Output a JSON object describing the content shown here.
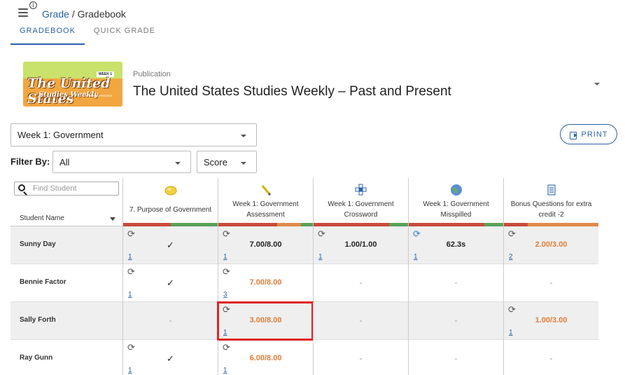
{
  "header": {
    "breadcrumb_parent": "Grade",
    "breadcrumb_sep": "/",
    "breadcrumb_current": "Gradebook",
    "info_glyph": "i"
  },
  "tabs": [
    {
      "label": "GRADEBOOK",
      "active": true
    },
    {
      "label": "QUICK GRADE",
      "active": false
    }
  ],
  "publication": {
    "label": "Publication",
    "title": "The United States Studies Weekly – Past and Present",
    "logo_text_main": "The United States",
    "logo_text_sub": "Studies Weekly",
    "logo_week": "WEEK 1",
    "logo_tag": "PAST AND PRESENT"
  },
  "controls": {
    "week_select": "Week 1: Government",
    "filter_label": "Filter By:",
    "filter_all": "All",
    "filter_score": "Score",
    "print_label": "PRINT"
  },
  "grid": {
    "search_placeholder": "Find Student",
    "name_column_label": "Student Name",
    "activities": [
      {
        "title": "7. Purpose of Government",
        "icon": "lemon-icon"
      },
      {
        "title": "Week 1: Government Assessment",
        "icon": "pencil-icon"
      },
      {
        "title": "Week 1: Government Crossword",
        "icon": "crossword-icon"
      },
      {
        "title": "Week 1: Government Misspilled",
        "icon": "globe-icon"
      },
      {
        "title": "Bonus Questions for extra credit -2",
        "icon": "document-icon"
      }
    ],
    "rows": [
      {
        "name": "Sunny Day",
        "cells": [
          "✓",
          "7.00/8.00",
          "1.00/1.00",
          "62.3s",
          "2.00/3.00"
        ],
        "counts": [
          "1",
          "1",
          "1",
          "1",
          "2"
        ]
      },
      {
        "name": "Bennie Factor",
        "cells": [
          "✓",
          "7.00/8.00",
          "-",
          "-",
          "-"
        ],
        "counts": [
          "1",
          "3",
          "",
          "",
          ""
        ]
      },
      {
        "name": "Sally Forth",
        "cells": [
          "-",
          "3.00/8.00",
          "-",
          "-",
          "1.00/3.00"
        ],
        "counts": [
          "",
          "1",
          "",
          "",
          "1"
        ]
      },
      {
        "name": "Ray Gunn",
        "cells": [
          "✓",
          "6.00/8.00",
          "-",
          "-",
          "-"
        ],
        "counts": [
          "1",
          "1",
          "",
          "",
          ""
        ]
      }
    ]
  },
  "colors": {
    "accent": "#2a62a8",
    "warning_score": "#e07d38",
    "highlight": "#e02424",
    "bar_red": "#c94a3b",
    "bar_green": "#5aa05a",
    "bar_orange": "#e08a4a"
  }
}
